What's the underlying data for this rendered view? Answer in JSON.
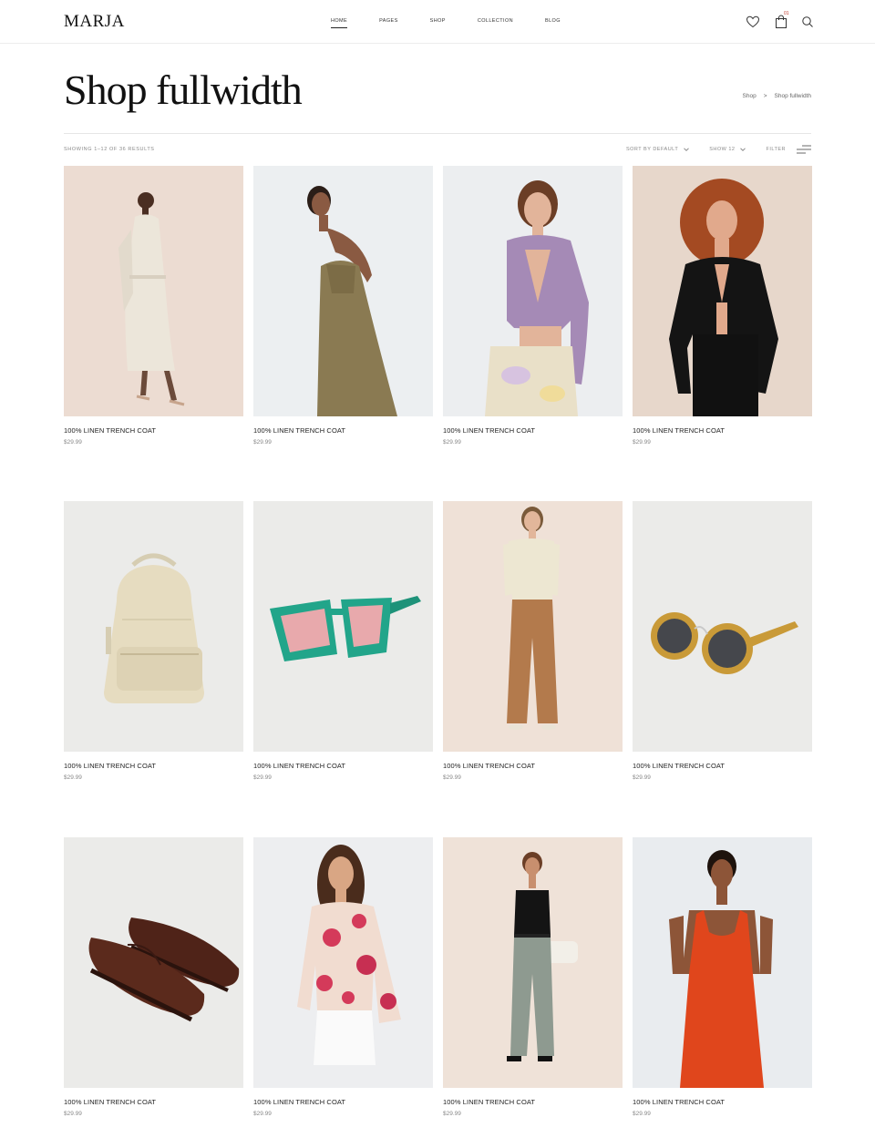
{
  "header": {
    "logo": "MARJA",
    "nav": [
      "HOME",
      "PAGES",
      "SHOP",
      "COLLECTION",
      "BLOG"
    ],
    "cart_count": "01"
  },
  "page": {
    "title": "Shop fullwidth",
    "breadcrumb": [
      "Shop",
      ">",
      "Shop fullwidth"
    ]
  },
  "toolbar": {
    "results": "SHOWING 1–12 OF 36 RESULTS",
    "sort_label": "SORT BY DEFAULT",
    "show_label": "SHOW 12",
    "filter_label": "FILTER"
  },
  "products": [
    {
      "name": "100% LINEN TRENCH COAT",
      "price": "$29.99",
      "image": "woman-beige-coat"
    },
    {
      "name": "100% LINEN TRENCH COAT",
      "price": "$29.99",
      "image": "woman-olive-dress"
    },
    {
      "name": "100% LINEN TRENCH COAT",
      "price": "$29.99",
      "image": "woman-lilac-ruffle-top"
    },
    {
      "name": "100% LINEN TRENCH COAT",
      "price": "$29.99",
      "image": "woman-black-cardigan"
    },
    {
      "name": "100% LINEN TRENCH COAT",
      "price": "$29.99",
      "image": "beige-backpack"
    },
    {
      "name": "100% LINEN TRENCH COAT",
      "price": "$29.99",
      "image": "green-square-sunglasses"
    },
    {
      "name": "100% LINEN TRENCH COAT",
      "price": "$29.99",
      "image": "woman-cream-top-tan-trousers"
    },
    {
      "name": "100% LINEN TRENCH COAT",
      "price": "$29.99",
      "image": "mustard-round-sunglasses"
    },
    {
      "name": "100% LINEN TRENCH COAT",
      "price": "$29.99",
      "image": "brown-penny-loafers"
    },
    {
      "name": "100% LINEN TRENCH COAT",
      "price": "$29.99",
      "image": "woman-floral-shirt"
    },
    {
      "name": "100% LINEN TRENCH COAT",
      "price": "$29.99",
      "image": "woman-grey-trousers"
    },
    {
      "name": "100% LINEN TRENCH COAT",
      "price": "$29.99",
      "image": "woman-orange-jumpsuit"
    }
  ],
  "colors": {
    "text": "#1a1a1a",
    "muted": "#888888",
    "divider": "#e6e6e6",
    "cart_badge": "#c0392b"
  }
}
